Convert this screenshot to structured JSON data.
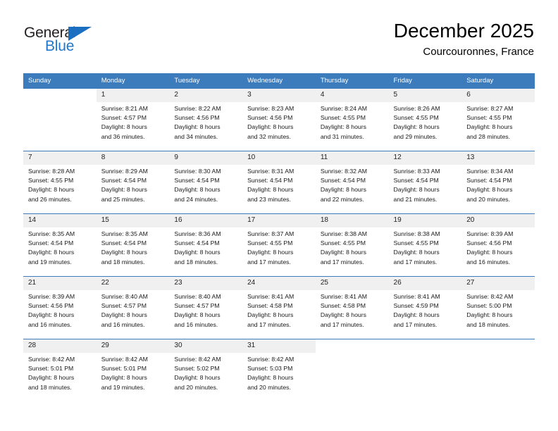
{
  "brand": {
    "line1": "General",
    "line2": "Blue",
    "triangle_icon": "triangle-icon",
    "color_dark": "#231f20",
    "color_blue": "#2277c8"
  },
  "header": {
    "title": "December 2025",
    "subtitle": "Courcouronnes, France"
  },
  "theme": {
    "header_blue": "#3c7cbd",
    "daynum_bg": "#f0f0f0"
  },
  "calendar": {
    "weekday_headers": [
      "Sunday",
      "Monday",
      "Tuesday",
      "Wednesday",
      "Thursday",
      "Friday",
      "Saturday"
    ],
    "weeks": [
      [
        {
          "day": "",
          "lines": []
        },
        {
          "day": "1",
          "lines": [
            "Sunrise: 8:21 AM",
            "Sunset: 4:57 PM",
            "Daylight: 8 hours",
            "and 36 minutes."
          ]
        },
        {
          "day": "2",
          "lines": [
            "Sunrise: 8:22 AM",
            "Sunset: 4:56 PM",
            "Daylight: 8 hours",
            "and 34 minutes."
          ]
        },
        {
          "day": "3",
          "lines": [
            "Sunrise: 8:23 AM",
            "Sunset: 4:56 PM",
            "Daylight: 8 hours",
            "and 32 minutes."
          ]
        },
        {
          "day": "4",
          "lines": [
            "Sunrise: 8:24 AM",
            "Sunset: 4:55 PM",
            "Daylight: 8 hours",
            "and 31 minutes."
          ]
        },
        {
          "day": "5",
          "lines": [
            "Sunrise: 8:26 AM",
            "Sunset: 4:55 PM",
            "Daylight: 8 hours",
            "and 29 minutes."
          ]
        },
        {
          "day": "6",
          "lines": [
            "Sunrise: 8:27 AM",
            "Sunset: 4:55 PM",
            "Daylight: 8 hours",
            "and 28 minutes."
          ]
        }
      ],
      [
        {
          "day": "7",
          "lines": [
            "Sunrise: 8:28 AM",
            "Sunset: 4:55 PM",
            "Daylight: 8 hours",
            "and 26 minutes."
          ]
        },
        {
          "day": "8",
          "lines": [
            "Sunrise: 8:29 AM",
            "Sunset: 4:54 PM",
            "Daylight: 8 hours",
            "and 25 minutes."
          ]
        },
        {
          "day": "9",
          "lines": [
            "Sunrise: 8:30 AM",
            "Sunset: 4:54 PM",
            "Daylight: 8 hours",
            "and 24 minutes."
          ]
        },
        {
          "day": "10",
          "lines": [
            "Sunrise: 8:31 AM",
            "Sunset: 4:54 PM",
            "Daylight: 8 hours",
            "and 23 minutes."
          ]
        },
        {
          "day": "11",
          "lines": [
            "Sunrise: 8:32 AM",
            "Sunset: 4:54 PM",
            "Daylight: 8 hours",
            "and 22 minutes."
          ]
        },
        {
          "day": "12",
          "lines": [
            "Sunrise: 8:33 AM",
            "Sunset: 4:54 PM",
            "Daylight: 8 hours",
            "and 21 minutes."
          ]
        },
        {
          "day": "13",
          "lines": [
            "Sunrise: 8:34 AM",
            "Sunset: 4:54 PM",
            "Daylight: 8 hours",
            "and 20 minutes."
          ]
        }
      ],
      [
        {
          "day": "14",
          "lines": [
            "Sunrise: 8:35 AM",
            "Sunset: 4:54 PM",
            "Daylight: 8 hours",
            "and 19 minutes."
          ]
        },
        {
          "day": "15",
          "lines": [
            "Sunrise: 8:35 AM",
            "Sunset: 4:54 PM",
            "Daylight: 8 hours",
            "and 18 minutes."
          ]
        },
        {
          "day": "16",
          "lines": [
            "Sunrise: 8:36 AM",
            "Sunset: 4:54 PM",
            "Daylight: 8 hours",
            "and 18 minutes."
          ]
        },
        {
          "day": "17",
          "lines": [
            "Sunrise: 8:37 AM",
            "Sunset: 4:55 PM",
            "Daylight: 8 hours",
            "and 17 minutes."
          ]
        },
        {
          "day": "18",
          "lines": [
            "Sunrise: 8:38 AM",
            "Sunset: 4:55 PM",
            "Daylight: 8 hours",
            "and 17 minutes."
          ]
        },
        {
          "day": "19",
          "lines": [
            "Sunrise: 8:38 AM",
            "Sunset: 4:55 PM",
            "Daylight: 8 hours",
            "and 17 minutes."
          ]
        },
        {
          "day": "20",
          "lines": [
            "Sunrise: 8:39 AM",
            "Sunset: 4:56 PM",
            "Daylight: 8 hours",
            "and 16 minutes."
          ]
        }
      ],
      [
        {
          "day": "21",
          "lines": [
            "Sunrise: 8:39 AM",
            "Sunset: 4:56 PM",
            "Daylight: 8 hours",
            "and 16 minutes."
          ]
        },
        {
          "day": "22",
          "lines": [
            "Sunrise: 8:40 AM",
            "Sunset: 4:57 PM",
            "Daylight: 8 hours",
            "and 16 minutes."
          ]
        },
        {
          "day": "23",
          "lines": [
            "Sunrise: 8:40 AM",
            "Sunset: 4:57 PM",
            "Daylight: 8 hours",
            "and 16 minutes."
          ]
        },
        {
          "day": "24",
          "lines": [
            "Sunrise: 8:41 AM",
            "Sunset: 4:58 PM",
            "Daylight: 8 hours",
            "and 17 minutes."
          ]
        },
        {
          "day": "25",
          "lines": [
            "Sunrise: 8:41 AM",
            "Sunset: 4:58 PM",
            "Daylight: 8 hours",
            "and 17 minutes."
          ]
        },
        {
          "day": "26",
          "lines": [
            "Sunrise: 8:41 AM",
            "Sunset: 4:59 PM",
            "Daylight: 8 hours",
            "and 17 minutes."
          ]
        },
        {
          "day": "27",
          "lines": [
            "Sunrise: 8:42 AM",
            "Sunset: 5:00 PM",
            "Daylight: 8 hours",
            "and 18 minutes."
          ]
        }
      ],
      [
        {
          "day": "28",
          "lines": [
            "Sunrise: 8:42 AM",
            "Sunset: 5:01 PM",
            "Daylight: 8 hours",
            "and 18 minutes."
          ]
        },
        {
          "day": "29",
          "lines": [
            "Sunrise: 8:42 AM",
            "Sunset: 5:01 PM",
            "Daylight: 8 hours",
            "and 19 minutes."
          ]
        },
        {
          "day": "30",
          "lines": [
            "Sunrise: 8:42 AM",
            "Sunset: 5:02 PM",
            "Daylight: 8 hours",
            "and 20 minutes."
          ]
        },
        {
          "day": "31",
          "lines": [
            "Sunrise: 8:42 AM",
            "Sunset: 5:03 PM",
            "Daylight: 8 hours",
            "and 20 minutes."
          ]
        },
        {
          "day": "",
          "lines": []
        },
        {
          "day": "",
          "lines": []
        },
        {
          "day": "",
          "lines": []
        }
      ]
    ]
  }
}
